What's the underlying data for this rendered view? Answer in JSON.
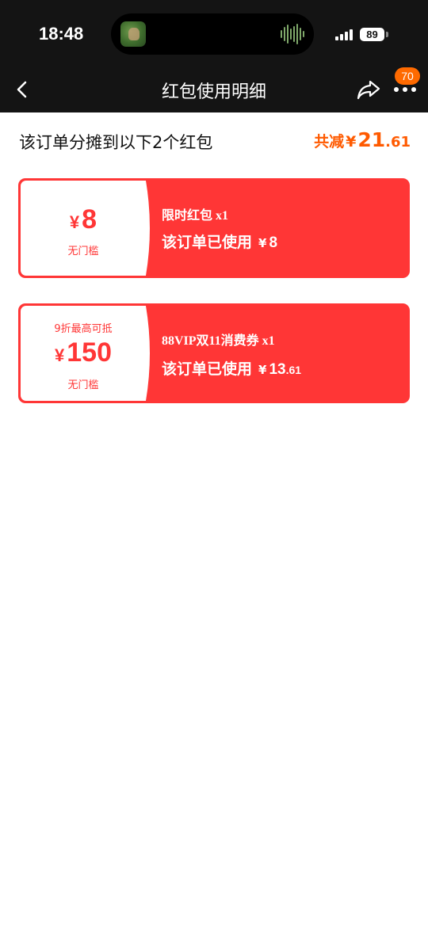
{
  "status_bar": {
    "time": "18:48",
    "battery": "89",
    "icons": [
      "now-playing-album-art",
      "audio-waveform-icon",
      "signal-icon",
      "battery-icon"
    ]
  },
  "nav": {
    "title": "红包使用明细",
    "badge": "70",
    "icons": [
      "chevron-left-icon",
      "share-icon",
      "more-icon"
    ]
  },
  "summary": {
    "text": "该订单分摊到以下2个红包",
    "total_label": "共减",
    "currency": "¥",
    "total_int": "21",
    "total_dec": ".61"
  },
  "coupons": [
    {
      "note": "",
      "currency": "¥",
      "amount": "8",
      "threshold": "无门槛",
      "name": "限时红包 x1",
      "usage_label": "该订单已使用",
      "usage_currency": "¥",
      "usage_int": "8",
      "usage_dec": ""
    },
    {
      "note": "9折最高可抵",
      "currency": "¥",
      "amount": "150",
      "threshold": "无门槛",
      "name": "88VIP双11消费券 x1",
      "usage_label": "该订单已使用",
      "usage_currency": "¥",
      "usage_int": "13",
      "usage_dec": ".61"
    }
  ],
  "colors": {
    "accent_red": "#ff3636",
    "accent_orange": "#ff5a00",
    "header_bg": "#141414",
    "badge_bg": "#ff6a00"
  }
}
